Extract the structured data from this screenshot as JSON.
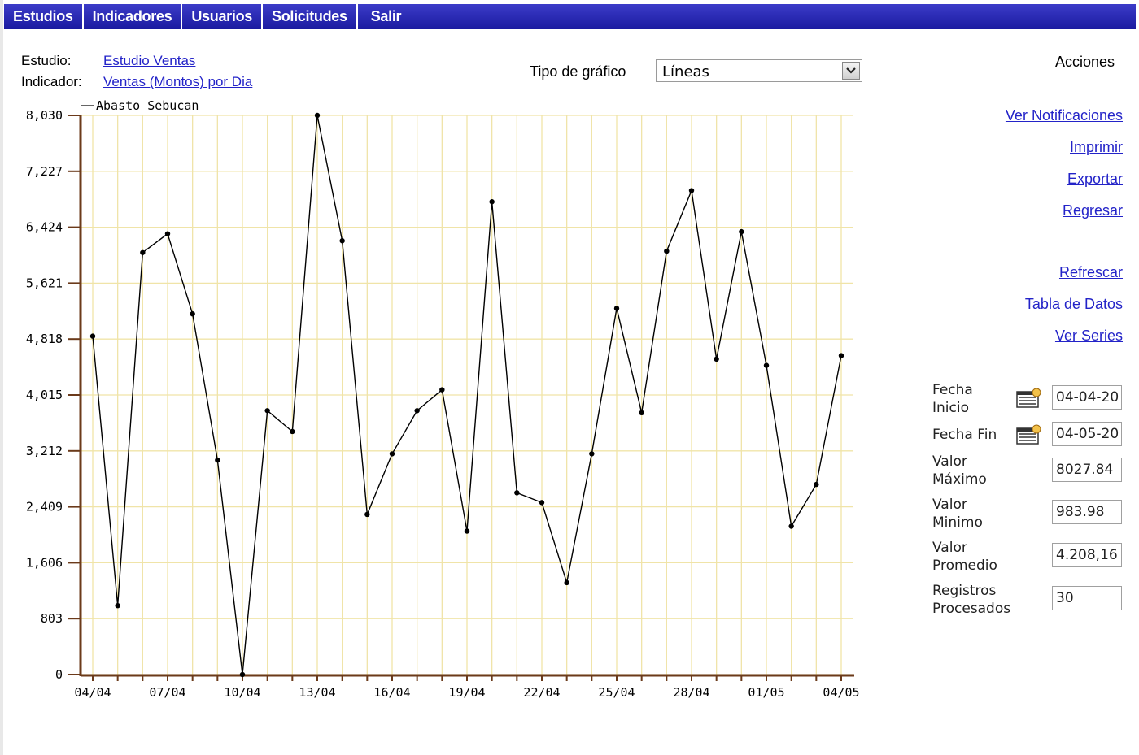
{
  "nav": {
    "items": [
      "Estudios",
      "Indicadores",
      "Usuarios",
      "Solicitudes",
      "Salir"
    ]
  },
  "header": {
    "estudio_label": "Estudio:",
    "estudio_value": "Estudio Ventas",
    "indicador_label": "Indicador:",
    "indicador_value": "Ventas (Montos) por Dia",
    "tipo_label": "Tipo de gráfico",
    "tipo_value": "Líneas"
  },
  "actions": {
    "title": "Acciones",
    "links": [
      "Ver Notificaciones",
      "Imprimir",
      "Exportar",
      "Regresar",
      "Refrescar",
      "Tabla de Datos",
      "Ver Series"
    ]
  },
  "filters": {
    "fecha_inicio_label": "Fecha Inicio",
    "fecha_inicio_value": "04-04-20",
    "fecha_fin_label": "Fecha Fin",
    "fecha_fin_value": "04-05-20",
    "valor_maximo_label": "Valor Máximo",
    "valor_maximo_value": "8027.84",
    "valor_minimo_label": "Valor Minimo",
    "valor_minimo_value": "983.98",
    "valor_promedio_label": "Valor Promedio",
    "valor_promedio_value": "4.208,16",
    "registros_label": "Registros Procesados",
    "registros_value": "30"
  },
  "chart_data": {
    "type": "line",
    "series": [
      {
        "name": "Abasto Sebucan",
        "values": [
          4860,
          990,
          6060,
          6330,
          5180,
          3080,
          0,
          3790,
          3490,
          8030,
          6230,
          2300,
          3170,
          3790,
          4090,
          2060,
          6790,
          2610,
          2470,
          1320,
          3170,
          5260,
          3760,
          6080,
          6950,
          4530,
          6360,
          4440,
          2130,
          2730,
          4580
        ]
      }
    ],
    "x": [
      "04/04",
      "05/04",
      "06/04",
      "07/04",
      "08/04",
      "09/04",
      "10/04",
      "11/04",
      "12/04",
      "13/04",
      "14/04",
      "15/04",
      "16/04",
      "17/04",
      "18/04",
      "19/04",
      "20/04",
      "21/04",
      "22/04",
      "23/04",
      "24/04",
      "25/04",
      "26/04",
      "27/04",
      "28/04",
      "29/04",
      "30/04",
      "01/05",
      "02/05",
      "03/05",
      "04/05"
    ],
    "x_tick_labels": [
      "04/04",
      "07/04",
      "10/04",
      "13/04",
      "16/04",
      "19/04",
      "22/04",
      "25/04",
      "28/04",
      "01/05",
      "04/05"
    ],
    "y_tick_labels": [
      "0",
      "803",
      "1,606",
      "2,409",
      "3,212",
      "4,015",
      "4,818",
      "5,621",
      "6,424",
      "7,227",
      "8,030"
    ],
    "ylim": [
      0,
      8030
    ],
    "grid": true,
    "legend": "top-left",
    "colors": {
      "line": "#000000",
      "grid": "#f0e4a8",
      "axis": "#6b3a1a"
    }
  }
}
